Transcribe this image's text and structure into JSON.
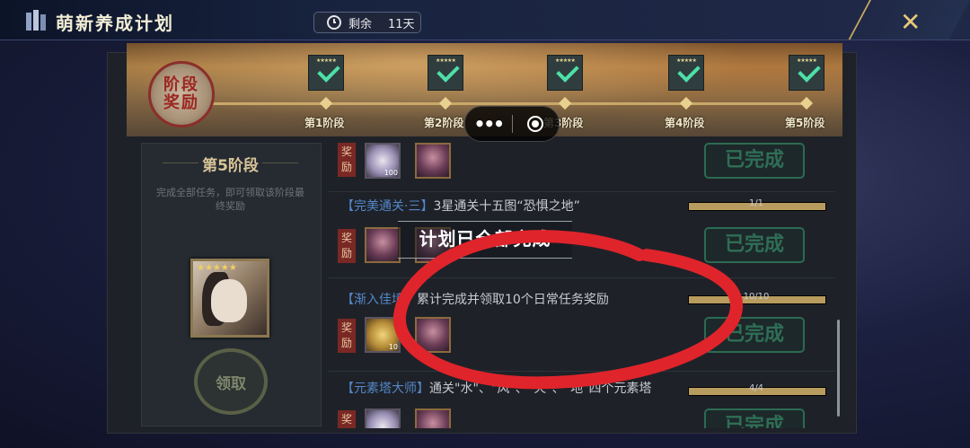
{
  "app": {
    "title": "萌新养成计划"
  },
  "timer": {
    "prefix": "剩余",
    "value": "11天"
  },
  "stages": {
    "seal_line1": "阶段",
    "seal_line2": "奖励",
    "labels": [
      "第1阶段",
      "第2阶段",
      "第3阶段",
      "第4阶段",
      "第5阶段"
    ],
    "stars": "★★★★★"
  },
  "left": {
    "title": "第5阶段",
    "desc": "完成全部任务，即可领取该阶段最终奖励",
    "portrait_stars": "★★★★★",
    "claim": "领取"
  },
  "tasks": [
    {
      "tag": "",
      "text": "",
      "reward_label": "奖励",
      "items": [
        {
          "kind": "crystal",
          "count": "100"
        },
        {
          "kind": "hero",
          "count": ""
        }
      ],
      "button": "已完成"
    },
    {
      "tag": "【完美通关·三】",
      "text": "3星通关十五图“恐惧之地”",
      "progress": "1/1",
      "progress_pct": 100,
      "reward_label": "奖励",
      "items": [
        {
          "kind": "hero",
          "count": ""
        },
        {
          "kind": "hero",
          "count": ""
        }
      ],
      "button": "已完成"
    },
    {
      "tag": "【渐入佳境】",
      "text": "累计完成并领取10个日常任务奖励",
      "progress": "10/10",
      "progress_pct": 100,
      "reward_label": "奖励",
      "items": [
        {
          "kind": "scroll",
          "count": "10"
        },
        {
          "kind": "hero",
          "count": ""
        }
      ],
      "button": "已完成"
    },
    {
      "tag": "【元素塔大师】",
      "text": "通关\"水\"、\"风\"、\"火\"、\"地\"四个元素塔",
      "progress": "4/4",
      "progress_pct": 100,
      "reward_label": "奖",
      "items": [
        {
          "kind": "crystal",
          "count": ""
        },
        {
          "kind": "hero",
          "count": ""
        }
      ],
      "button": "已完成"
    }
  ],
  "mini_program": {
    "more": "•••"
  },
  "toast": "计划已全部完成",
  "colors": {
    "accent_gold": "#c9a85d",
    "done_green": "#2f6e55",
    "tag_blue": "#5487c8",
    "ink_red": "#e0242b"
  }
}
